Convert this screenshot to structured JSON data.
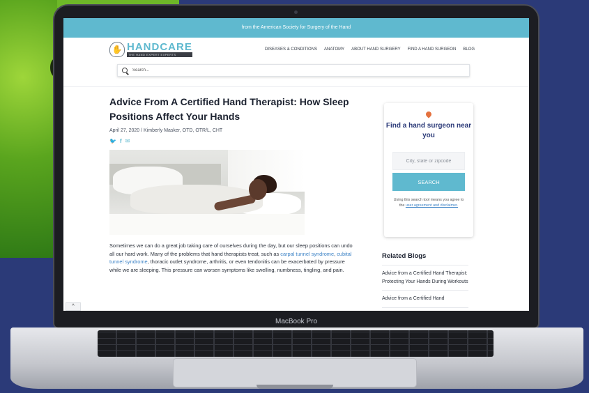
{
  "site": {
    "topbar_text": "from the American Society for Surgery of the Hand",
    "logo_title": "HANDCARE",
    "logo_tagline": "THE HAND EXPERT EXPERTS",
    "nav": [
      "DISEASES & CONDITIONS",
      "ANATOMY",
      "ABOUT HAND SURGERY",
      "FIND A HAND SURGEON",
      "BLOG"
    ],
    "search_placeholder": "Search..."
  },
  "article": {
    "title": "Advice From A Certified Hand Therapist: How Sleep Positions Affect Your Hands",
    "meta": "April 27, 2020 / Kimberly Masker, OTD, OTR/L, CHT",
    "body_1": "Sometimes we can do a great job taking care of ourselves during the day, but our sleep positions can undo all our hard work. Many of the problems that hand therapists treat, such as ",
    "link_1": "carpal tunnel syndrome",
    "sep_1": ", ",
    "link_2": "cubital tunnel syndrome",
    "body_2": ", thoracic outlet syndrome, arthritis, or even tendonitis can be exacerbated by pressure while we are sleeping. This pressure can worsen symptoms like swelling, numbness, tingling, and pain."
  },
  "surgeon_finder": {
    "title": "Find a hand surgeon near you",
    "input_placeholder": "City, state or zipcode",
    "button_label": "SEARCH",
    "disclaimer_text": "Using this search tool means you agree to the ",
    "disclaimer_link": "user agreement and disclaimer."
  },
  "related": {
    "title": "Related Blogs",
    "items": [
      "Advice from a Certified Hand Therapist: Protecting Your Hands During Workouts",
      "Advice from a Certified Hand"
    ]
  },
  "device": {
    "label": "MacBook Pro"
  },
  "scroll_top_icon": "^",
  "colors": {
    "background": "#2b3a78",
    "accent": "#5fb9cf",
    "link": "#3d83c6",
    "pin": "#e4713e"
  }
}
